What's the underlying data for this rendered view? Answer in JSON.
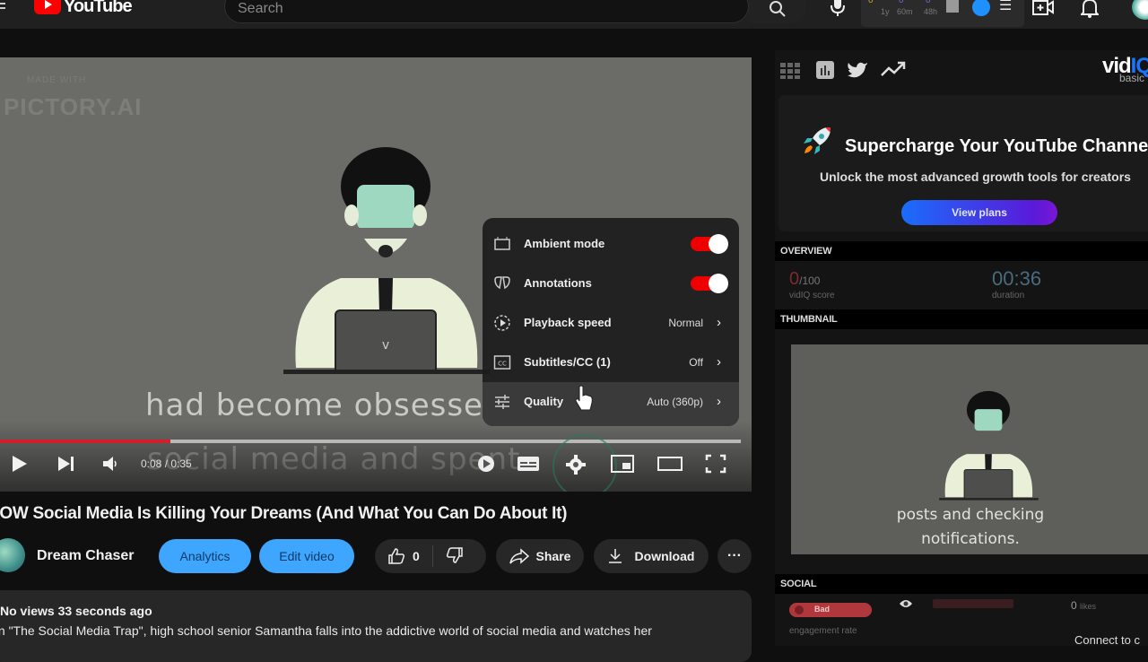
{
  "header": {
    "logo_text": "YouTube",
    "search_placeholder": "Search",
    "vidiq_stats": [
      {
        "value": "0",
        "label": "1y",
        "color": "#c9a227"
      },
      {
        "value": "0",
        "label": "60m",
        "color": "#6b6bd1"
      },
      {
        "value": "0",
        "label": "48h",
        "color": "#6b6bd1"
      }
    ],
    "icons": [
      "menu-icon",
      "search-icon",
      "microphone-icon",
      "vidiq-chart-icon",
      "vidiq-badge-icon",
      "list-icon",
      "create-video-icon",
      "notifications-bell-icon",
      "account-avatar"
    ]
  },
  "video": {
    "watermark_small": "MADE WITH",
    "watermark": "PICTORY.AI",
    "subtitle_line1": "had become obsesse",
    "subtitle_line2": "social media and spent",
    "progress": 0.23,
    "current_time": "0:08",
    "duration": "0:35",
    "time_text": "0:08 / 0:35"
  },
  "settings_menu": {
    "items": [
      {
        "label": "Ambient mode",
        "icon": "ambient-mode-icon",
        "type": "toggle",
        "on": true
      },
      {
        "label": "Annotations",
        "icon": "annotations-icon",
        "type": "toggle",
        "on": true
      },
      {
        "label": "Playback speed",
        "icon": "playback-speed-icon",
        "type": "submenu",
        "value": "Normal"
      },
      {
        "label": "Subtitles/CC (1)",
        "icon": "subtitles-icon",
        "type": "submenu",
        "value": "Off"
      },
      {
        "label": "Quality",
        "icon": "quality-icon",
        "type": "submenu",
        "value": "Auto (360p)"
      }
    ]
  },
  "video_info": {
    "title": "HOW Social Media Is Killing Your Dreams (And What You Can Do About It)",
    "channel": "Dream Chaser",
    "analytics_label": "Analytics",
    "edit_label": "Edit video",
    "likes": "0",
    "share_label": "Share",
    "download_label": "Download",
    "views": "No views",
    "posted": "33 seconds ago",
    "meta": "No views  33 seconds ago",
    "description": "In \"The Social Media Trap\", high school senior Samantha falls into the addictive world of social media and watches her"
  },
  "vidiq_panel": {
    "logo": "vidIQ",
    "tier": "basic",
    "promo_title": "Supercharge Your YouTube Channel",
    "promo_subtitle": "Unlock the most advanced growth tools for creators",
    "view_plans_label": "View plans",
    "overview_header": "OVERVIEW",
    "score_value": "0",
    "score_max": "/100",
    "score_label": "vidIQ score",
    "duration_value": "00:36",
    "duration_label": "duration",
    "thumbnail_header": "THUMBNAIL",
    "thumbnail_subtitle_line1": "posts and checking",
    "thumbnail_subtitle_line2": "notifications.",
    "social_header": "SOCIAL",
    "engagement_badge": "Bad",
    "engagement_label": "engagement rate",
    "likes_text": "0",
    "likes_label": "likes",
    "connect_text": "Connect to c"
  }
}
